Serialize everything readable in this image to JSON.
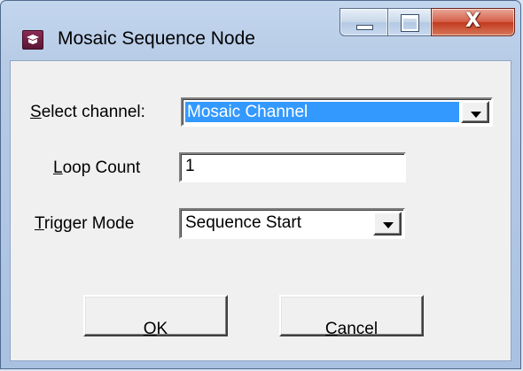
{
  "window": {
    "title": "Mosaic Sequence Node",
    "controls": {
      "minimize": "minimize",
      "maximize": "maximize",
      "close_glyph": "X"
    }
  },
  "form": {
    "channel": {
      "label_acc": "S",
      "label_rest": "elect channel:",
      "value": "Mosaic Channel",
      "icon": "chevron-down-icon"
    },
    "loop_count": {
      "label_acc": "L",
      "label_rest": "oop Count",
      "value": "1"
    },
    "trigger_mode": {
      "label_acc": "T",
      "label_rest": "rigger Mode",
      "value": "Sequence Start",
      "icon": "chevron-down-icon"
    }
  },
  "buttons": {
    "ok": {
      "acc": "O",
      "rest": "K"
    },
    "cancel": {
      "acc": "C",
      "rest": "ancel"
    }
  },
  "colors": {
    "selection": "#3399ff",
    "close_button": "#c23a1f",
    "title_frame": "#b7cbe6"
  }
}
